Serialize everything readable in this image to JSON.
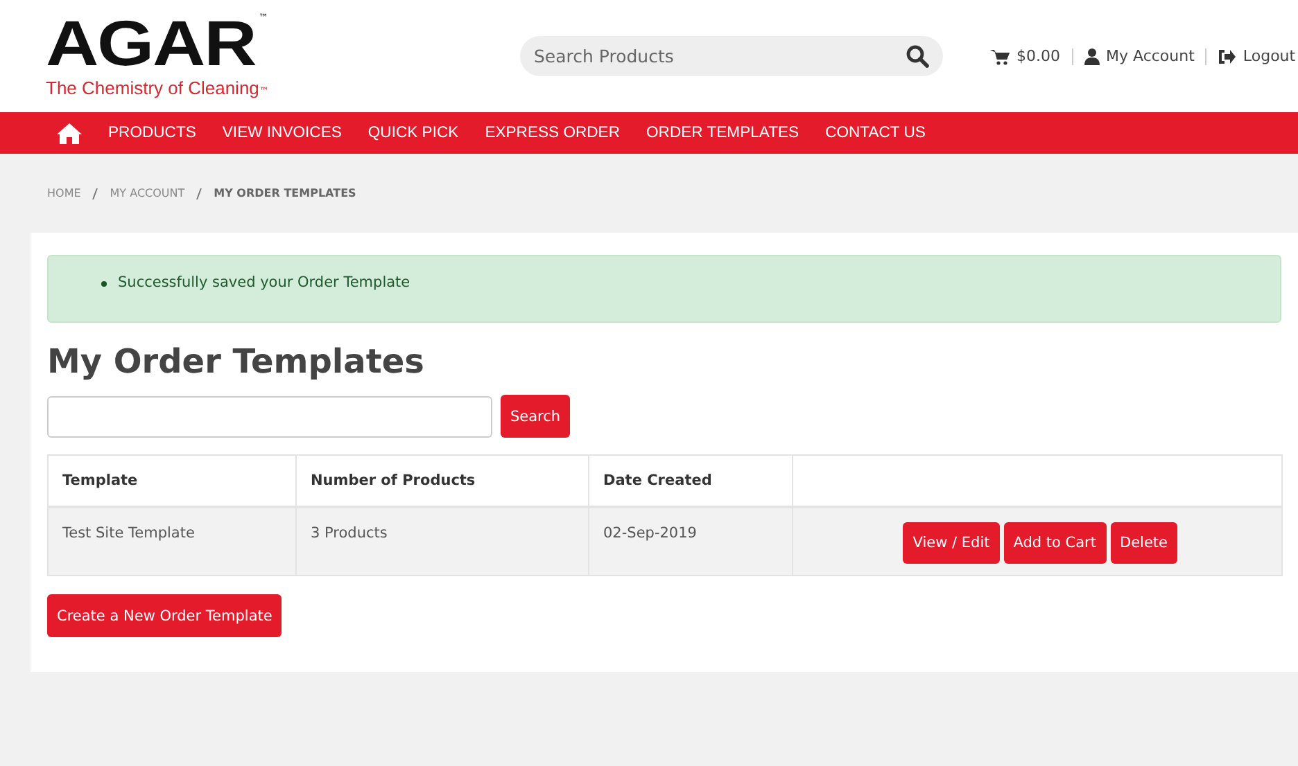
{
  "logo": {
    "name": "AGAR",
    "tm": "™",
    "tagline": "The Chemistry of Cleaning",
    "tagline_tm": "™"
  },
  "search": {
    "placeholder": "Search Products"
  },
  "account": {
    "cart": "$0.00",
    "my_account": "My Account",
    "logout": "Logout"
  },
  "nav": [
    "PRODUCTS",
    "VIEW INVOICES",
    "QUICK PICK",
    "EXPRESS ORDER",
    "ORDER TEMPLATES",
    "CONTACT US"
  ],
  "breadcrumb": [
    {
      "label": "HOME",
      "selected": false
    },
    {
      "label": "MY ACCOUNT",
      "selected": false
    },
    {
      "label": "MY ORDER TEMPLATES",
      "selected": true
    }
  ],
  "alert": "Successfully saved your Order Template",
  "heading": "My Order Templates",
  "filter": {
    "button": "Search"
  },
  "table": {
    "columns": [
      "Template",
      "Number of Products",
      "Date Created"
    ],
    "rows": [
      {
        "template": "Test Site Template",
        "products": "3 Products",
        "date": "02-Sep-2019",
        "actions": [
          "View / Edit",
          "Add to Cart",
          "Delete"
        ]
      }
    ]
  },
  "create_button": "Create a New Order Template"
}
